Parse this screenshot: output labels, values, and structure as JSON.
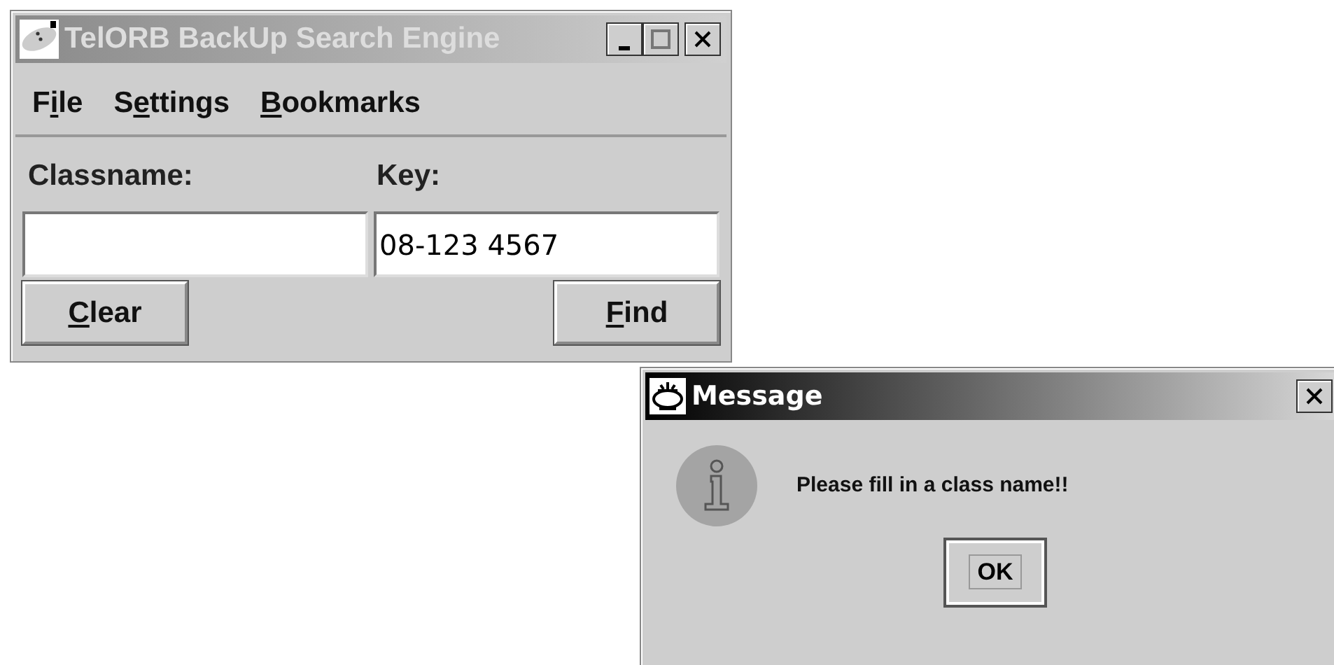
{
  "main_window": {
    "title": "TelORB BackUp Search Engine",
    "active": false,
    "menus": [
      {
        "pre": "F",
        "key": "i",
        "post": "le"
      },
      {
        "pre": "S",
        "key": "e",
        "post": "ttings"
      },
      {
        "key": "B",
        "post": "ookmarks"
      }
    ],
    "fields": [
      {
        "label": "Classname:"
      },
      {
        "label": "Key:",
        "value": "08-123 4567"
      }
    ],
    "buttons": [
      {
        "key": "C",
        "post": "lear"
      },
      {
        "key": "F",
        "post": "ind"
      }
    ]
  },
  "dialog": {
    "title": "Message",
    "active": true,
    "message": "Please fill in a class name!!",
    "button": {
      "label": "OK",
      "focused": true
    }
  }
}
